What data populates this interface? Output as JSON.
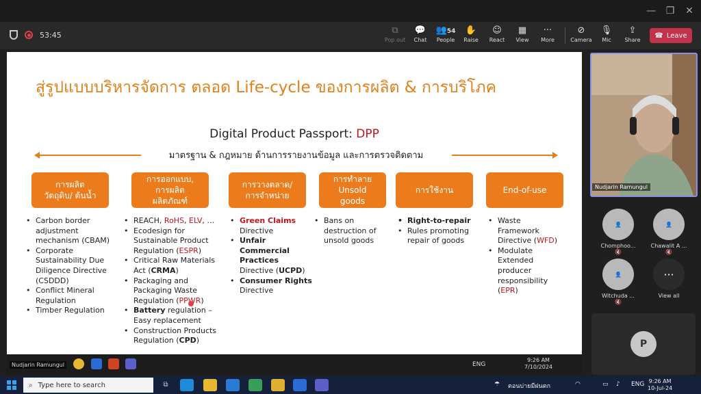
{
  "window": {
    "minimize_icon": "minimize-icon",
    "maximize_icon": "maximize-icon",
    "close_icon": "close-icon"
  },
  "meeting": {
    "timer": "53:45",
    "toolbar": [
      {
        "label": "Pop out",
        "icon": "pop-out-icon",
        "disabled": true
      },
      {
        "label": "Chat",
        "icon": "chat-icon"
      },
      {
        "label": "People",
        "icon": "people-icon",
        "count": "54"
      },
      {
        "label": "Raise",
        "icon": "hand-icon"
      },
      {
        "label": "React",
        "icon": "smile-icon"
      },
      {
        "label": "View",
        "icon": "grid-icon"
      },
      {
        "label": "More",
        "icon": "more-icon"
      },
      {
        "label": "Camera",
        "icon": "camera-off-icon"
      },
      {
        "label": "Mic",
        "icon": "mic-off-icon"
      },
      {
        "label": "Share",
        "icon": "share-icon"
      }
    ],
    "leave_label": "Leave",
    "accent": "#c4314b"
  },
  "slide": {
    "title": "สู่รูปแบบบริหารจัดการ ตลอด Life-cycle ของการผลิต & การบริโภค",
    "dpp_prefix": "Digital Product Passport: ",
    "dpp_red": "DPP",
    "subtitle": "มาตรฐาน & กฎหมาย ด้านการรายงานข้อมูล และการตรวจติดตาม",
    "orange": "#ec7c1b",
    "stages": [
      "การผลิต\nวัตถุดิบ/ ต้นน้ำ",
      "การออกแบบ,\nการผลิต\nผลิตภัณฑ์",
      "การวางตลาด/\nการจำหน่าย",
      "การทำลาย\nUnsold\ngoods",
      "การใช้งาน",
      "End-of-use"
    ],
    "col1": [
      "Carbon border adjustment mechanism (CBAM)",
      "Corporate Sustainability Due Diligence Directive (CSDDD)",
      "Conflict Mineral Regulation",
      "Timber Regulation"
    ],
    "col2": {
      "reach_prefix": "REACH, ",
      "rohs": "RoHS",
      "comma": ", ",
      "elv": "ELV",
      "ellipsis": ", …",
      "eco": "Ecodesign for Sustainable Product Regulation (",
      "espr": "ESPR",
      "close": ")",
      "crma_pre": "Critical Raw Materials Act (",
      "crma": "CRMA",
      "crma_close": ")",
      "ppwr_pre": "Packaging and Packaging Waste Regulation (",
      "ppwr": "PPWR",
      "ppwr_close": ")",
      "battery": "Battery",
      "battery_rest": " regulation – Easy replacement",
      "cpd_pre": "Construction Products Regulation (",
      "cpd": "CPD",
      "cpd_close": ")"
    },
    "col3": {
      "green": "Green Claims",
      "green_rest": " Directive",
      "unfair": "Unfair Commercial Practices",
      "unfair_rest": " Directive",
      "ucpd_pre": "(",
      "ucpd": "UCPD",
      "ucpd_close": ")",
      "consumer": "Consumer Rights",
      "consumer_rest": " Directive"
    },
    "col4": [
      "Bans on destruction of unsold goods"
    ],
    "col5": {
      "right": "Right-to-repair",
      "rules": "Rules promoting repair of goods"
    },
    "col6": {
      "waste_pre": "Waste Framework Directive (",
      "wfd": "WFD",
      "wfd_close": ")",
      "mod_pre": "Modulate Extended producer responsibility (",
      "epr": "EPR",
      "epr_close": ")"
    }
  },
  "participants": {
    "active_name": "Nudjarin Ramungul",
    "tiles": [
      {
        "name": "Chomphoo...",
        "icon": "person-icon"
      },
      {
        "name": "Chawalit A ...",
        "icon": "person-icon"
      },
      {
        "name": "Witchuda ...",
        "icon": "person-icon"
      },
      {
        "name": "View all",
        "icon": "more-icon"
      }
    ],
    "self_initial": "P"
  },
  "inner_taskbar": {
    "name": "Nudjarin Ramungul",
    "lang": "ENG",
    "time": "9:26 AM",
    "date": "7/10/2024"
  },
  "taskbar": {
    "search_placeholder": "Type here to search",
    "weather": "ตอนบ่ายมีฝนตก",
    "lang": "ENG",
    "time": "9:26 AM",
    "date": "10-Jul-24"
  }
}
